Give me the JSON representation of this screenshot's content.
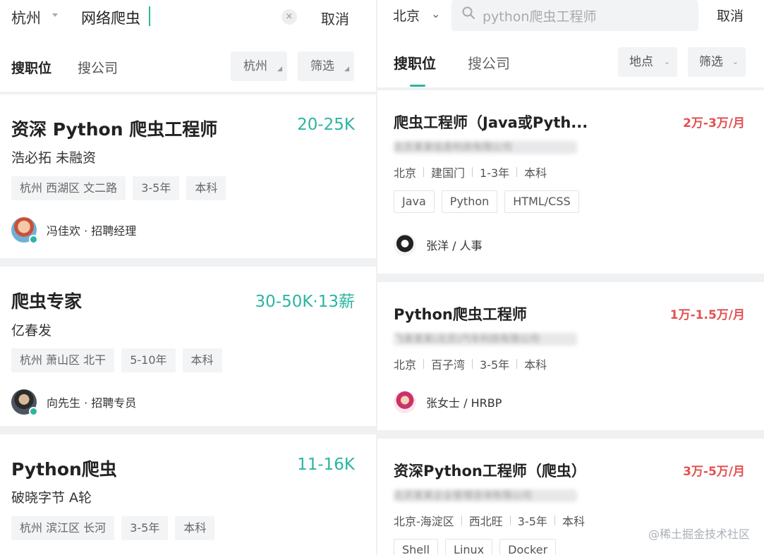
{
  "left": {
    "search": {
      "city": "杭州",
      "query": "网络爬虫",
      "clear": "×",
      "cancel": "取消"
    },
    "tabs": {
      "job": "搜职位",
      "company": "搜公司"
    },
    "filters": [
      {
        "label": "杭州"
      },
      {
        "label": "筛选"
      }
    ],
    "filter_marker": "◢",
    "jobs": [
      {
        "title": "资深 Python 爬虫工程师",
        "salary": "20-25K",
        "company": "浩必拓  未融资",
        "tags": [
          "杭州 西湖区 文二路",
          "3-5年",
          "本科"
        ],
        "recruiter": "冯佳欢 · 招聘经理"
      },
      {
        "title": "爬虫专家",
        "salary": "30-50K·13薪",
        "company": "亿春发",
        "tags": [
          "杭州 萧山区 北干",
          "5-10年",
          "本科"
        ],
        "recruiter": "向先生 · 招聘专员"
      },
      {
        "title": "Python爬虫",
        "salary": "11-16K",
        "company": "破晓字节  A轮",
        "tags": [
          "杭州 滨江区 长河",
          "3-5年",
          "本科"
        ]
      }
    ]
  },
  "right": {
    "search": {
      "city": "北京",
      "city_caret": "⌄",
      "placeholder": "python爬虫工程师",
      "cancel": "取消"
    },
    "tabs": {
      "job": "搜职位",
      "company": "搜公司"
    },
    "filters": [
      {
        "label": "地点"
      },
      {
        "label": "筛选"
      }
    ],
    "filter_marker": "⌄",
    "jobs": [
      {
        "title": "爬虫工程师（Java或Pyth...",
        "salary": "2万-3万/月",
        "company_blurred": "北京某某信息科技有限公司",
        "meta": [
          "北京",
          "建国门",
          "1-3年",
          "本科"
        ],
        "tags": [
          "Java",
          "Python",
          "HTML/CSS"
        ],
        "recruiter": "张洋 / 人事"
      },
      {
        "title": "Python爬虫工程师",
        "salary": "1万-1.5万/月",
        "company_blurred": "飞某某某(北京)汽车科技有限公司",
        "meta": [
          "北京",
          "百子湾",
          "3-5年",
          "本科"
        ],
        "recruiter": "张女士 / HRBP"
      },
      {
        "title": "资深Python工程师（爬虫）",
        "salary": "3万-5万/月",
        "company_blurred": "北京某某企业管理咨询有限公司",
        "meta": [
          "北京-海淀区",
          "西北旺",
          "3-5年",
          "本科"
        ],
        "tags": [
          "Shell",
          "Linux",
          "Docker"
        ]
      }
    ]
  },
  "watermark": "@稀土掘金技术社区",
  "colors": {
    "accent": "#2bb5a2",
    "salary_right": "#e3514f"
  }
}
